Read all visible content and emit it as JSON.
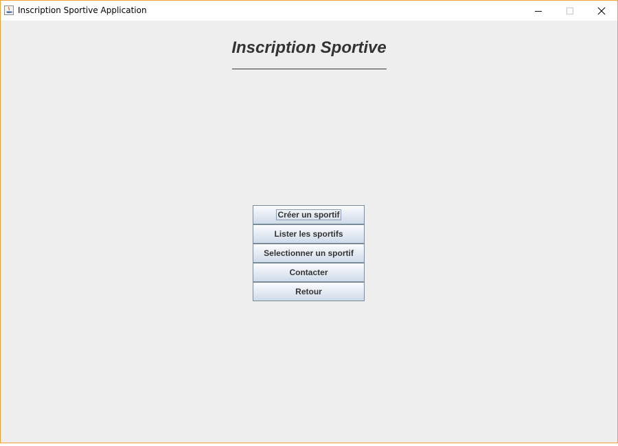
{
  "window": {
    "title": "Inscription Sportive Application",
    "controls": {
      "minimize": "minimize-icon",
      "maximize": "maximize-icon",
      "close": "close-icon"
    }
  },
  "main": {
    "heading": "Inscription Sportive",
    "menu": [
      {
        "label": "Créer un sportif",
        "focused": true
      },
      {
        "label": "Lister les sportifs",
        "focused": false
      },
      {
        "label": "Selectionner un sportif",
        "focused": false
      },
      {
        "label": "Contacter",
        "focused": false
      },
      {
        "label": "Retour",
        "focused": false
      }
    ]
  },
  "colors": {
    "window_border": "#f0a030",
    "background": "#eeeeee",
    "heading_text": "#333333",
    "button_border": "#7a8a99"
  }
}
